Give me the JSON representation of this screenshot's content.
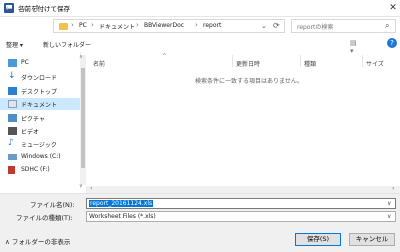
{
  "window": {
    "title": "名前を付けて保存",
    "close_glyph": "✕"
  },
  "nav": {
    "back": "←",
    "forward": "→",
    "up": "↑",
    "breadcrumbs": [
      {
        "label": "›"
      },
      {
        "label": "PC"
      },
      {
        "label": "ドキュメント"
      },
      {
        "label": "BBViewerDoc"
      },
      {
        "label": "report"
      }
    ],
    "separator": "›",
    "dropdown": "⌄",
    "refresh": "⟳"
  },
  "search": {
    "placeholder": "reportの検索",
    "icon": "search-icon"
  },
  "toolbar": {
    "organize": "整理 ▾",
    "new_folder": "新しいフォルダー",
    "view_icon": "▤ ▾",
    "help": "?"
  },
  "sidebar": {
    "items": [
      {
        "label": "PC",
        "icon": "pc-icon",
        "color": "#4a9ad6"
      },
      {
        "label": "ダウンロード",
        "icon": "download-icon",
        "color": "#1e6fc0"
      },
      {
        "label": "デスクトップ",
        "icon": "desktop-icon",
        "color": "#2b7fd0"
      },
      {
        "label": "ドキュメント",
        "icon": "documents-icon",
        "color": "#8a9fb8",
        "selected": true
      },
      {
        "label": "ピクチャ",
        "icon": "pictures-icon",
        "color": "#4f8fc9"
      },
      {
        "label": "ビデオ",
        "icon": "video-icon",
        "color": "#555555"
      },
      {
        "label": "ミュージック",
        "icon": "music-icon",
        "color": "#1f7ad6"
      },
      {
        "label": "Windows (C:)",
        "icon": "drive-icon",
        "color": "#6b9bc8"
      },
      {
        "label": "SDHC (F:)",
        "icon": "sd-card-icon",
        "color": "#c0392b"
      }
    ]
  },
  "columns": [
    {
      "label": "名前"
    },
    {
      "label": "更新日時"
    },
    {
      "label": "種類"
    },
    {
      "label": "サイズ"
    }
  ],
  "empty_message": "検索条件に一致する項目はありません。",
  "form": {
    "filename_label": "ファイル名(N):",
    "filename_value": "report_20161124.xls",
    "filetype_label": "ファイルの種類(T):",
    "filetype_value": "Worksheet Files (*.xls)"
  },
  "footer": {
    "hide_folders": "∧ フォルダーの非表示",
    "save": "保存(S)",
    "cancel": "キャンセル"
  }
}
